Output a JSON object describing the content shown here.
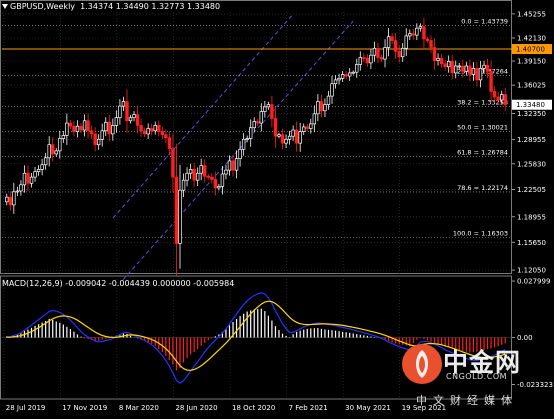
{
  "header": {
    "symbol": "GBPUSD,Weekly",
    "ohlc": "1.34374 1.34490 1.32773 1.33480"
  },
  "macd_header": "MACD(12,26,9) -0.009042 -0.004439 0.000000 -0.005984",
  "watermark": {
    "brand": "中金网",
    "domain": "CNGOLD.COM",
    "subtitle": "中文财经媒体"
  },
  "colors": {
    "background": "#000000",
    "grid": "#3a3a3a",
    "bull_candle": "#ffffff",
    "bear_candle": "#ff2020",
    "fib_line": "#bdbdbd",
    "resistance_line": "#ff9900",
    "price_tag": "#ffffff",
    "channel": "#5a4fd8",
    "macd_signal": "#ffd800",
    "macd_main": "#2233ff",
    "histogram_pos": "#ffffff",
    "histogram_neg": "#ff1f1f",
    "watermark_logo": "#e8502e"
  },
  "chart_data": [
    {
      "type": "candlestick",
      "title": "GBPUSD,Weekly",
      "ylim": [
        1.118,
        1.455
      ],
      "y_ticks": [
        "1.45255",
        "1.42130",
        "1.39150",
        "1.36025",
        "1.32350",
        "1.28955",
        "1.25830",
        "1.22505",
        "1.18955",
        "1.15650",
        "1.12050"
      ],
      "x_ticks": [
        "28 Jul 2019",
        "17 Nov 2019",
        "8 Mar 2020",
        "28 Jun 2020",
        "18 Oct 2020",
        "7 Feb 2021",
        "30 May 2021",
        "19 Sep 2021"
      ],
      "resistance": {
        "value": 1.407,
        "label": "1.40700"
      },
      "current_price": {
        "value": 1.3348,
        "label": "1.33480"
      },
      "fibonacci": [
        {
          "label": "0.0 = 1.43739",
          "value": 1.43739
        },
        {
          "label": "23.6 = 1.37264",
          "value": 1.37264
        },
        {
          "label": "38.2 = 1.33258",
          "value": 1.33258
        },
        {
          "label": "50.0 = 1.30021",
          "value": 1.30021
        },
        {
          "label": "61.8 = 1.26784",
          "value": 1.26784
        },
        {
          "label": "78.6 = 1.22174",
          "value": 1.22174
        },
        {
          "label": "100.0 = 1.16303",
          "value": 1.16303
        }
      ],
      "channel": {
        "upper": [
          {
            "t": 113,
            "price": 1.188
          },
          {
            "t": 293,
            "price": 1.452
          }
        ],
        "lower": [
          {
            "t": 123,
            "price": 1.108
          },
          {
            "t": 353,
            "price": 1.443
          }
        ]
      },
      "close": [
        1.215,
        1.205,
        1.222,
        1.223,
        1.231,
        1.246,
        1.233,
        1.241,
        1.248,
        1.251,
        1.257,
        1.266,
        1.283,
        1.271,
        1.275,
        1.291,
        1.295,
        1.311,
        1.307,
        1.3,
        1.307,
        1.302,
        1.314,
        1.301,
        1.297,
        1.283,
        1.29,
        1.301,
        1.312,
        1.297,
        1.308,
        1.318,
        1.333,
        1.339,
        1.314,
        1.318,
        1.322,
        1.308,
        1.301,
        1.297,
        1.304,
        1.301,
        1.308,
        1.3,
        1.296,
        1.292,
        1.278,
        1.241,
        1.155,
        1.224,
        1.237,
        1.246,
        1.251,
        1.237,
        1.246,
        1.256,
        1.242,
        1.241,
        1.238,
        1.227,
        1.229,
        1.245,
        1.25,
        1.262,
        1.25,
        1.265,
        1.277,
        1.29,
        1.291,
        1.305,
        1.313,
        1.311,
        1.326,
        1.332,
        1.335,
        1.317,
        1.294,
        1.296,
        1.285,
        1.29,
        1.294,
        1.302,
        1.285,
        1.3,
        1.306,
        1.304,
        1.31,
        1.323,
        1.339,
        1.327,
        1.335,
        1.346,
        1.362,
        1.367,
        1.369,
        1.374,
        1.372,
        1.376,
        1.377,
        1.387,
        1.396,
        1.395,
        1.389,
        1.399,
        1.408,
        1.396,
        1.394,
        1.409,
        1.423,
        1.418,
        1.404,
        1.397,
        1.408,
        1.424,
        1.427,
        1.425,
        1.434,
        1.436,
        1.42,
        1.418,
        1.409,
        1.392,
        1.395,
        1.388,
        1.384,
        1.391,
        1.376,
        1.385,
        1.385,
        1.378,
        1.385,
        1.374,
        1.382,
        1.367,
        1.382,
        1.386,
        1.378,
        1.352,
        1.345,
        1.341,
        1.348,
        1.335
      ],
      "histogram": [
        0.0006,
        0.0003,
        0.0011,
        0.0014,
        0.0021,
        0.0032,
        0.0039,
        0.0048,
        0.0058,
        0.0066,
        0.0074,
        0.0082,
        0.0092,
        0.0087,
        0.0079,
        0.0073,
        0.0064,
        0.0053,
        0.0042,
        0.0029,
        0.0015,
        0.0004,
        -0.0004,
        -0.0007,
        -0.0012,
        -0.0019,
        -0.0016,
        -0.0011,
        -0.0006,
        -0.0004,
        0.0002,
        0.0009,
        0.0016,
        0.0021,
        0.0018,
        0.0008,
        -0.0001,
        -0.0006,
        -0.0011,
        -0.0016,
        -0.0023,
        -0.0031,
        -0.0043,
        -0.0057,
        -0.0072,
        -0.0091,
        -0.0112,
        -0.0134,
        -0.0162,
        -0.0151,
        -0.0124,
        -0.0102,
        -0.0085,
        -0.0072,
        -0.0058,
        -0.0041,
        -0.0027,
        -0.0014,
        -0.0005,
        0.0006,
        0.0015,
        0.0028,
        0.0043,
        0.006,
        0.0077,
        0.0092,
        0.0106,
        0.0118,
        0.0129,
        0.0134,
        0.0139,
        0.0141,
        0.0143,
        0.0131,
        0.0108,
        0.0084,
        0.0056,
        0.0037,
        0.0019,
        0.0008,
        0.0002,
        0.0016,
        0.0028,
        0.0034,
        0.0039,
        0.0043,
        0.0045,
        0.0046,
        0.0047,
        0.0043,
        0.004,
        0.0038,
        0.0036,
        0.0034,
        0.0031,
        0.0028,
        0.0026,
        0.0023,
        0.002,
        0.0017,
        0.0014,
        0.0011,
        0.0008,
        0.0005,
        0.0002,
        -0.0003,
        -0.0008,
        -0.0014,
        -0.0021,
        -0.0025,
        -0.003,
        -0.0034,
        -0.0036,
        -0.004,
        -0.0044,
        -0.0028,
        -0.0012,
        -0.0002,
        -0.0009,
        -0.0014,
        -0.0021,
        -0.0027,
        -0.0032,
        -0.0038,
        -0.0046,
        -0.0049,
        -0.0053,
        -0.0058,
        -0.0062,
        -0.0066,
        -0.007,
        -0.0074,
        -0.0073,
        -0.0071,
        -0.0066,
        -0.0062,
        -0.0058,
        -0.0054,
        -0.0049,
        -0.0044,
        -0.0036,
        -0.0029
      ],
      "macd_ylim": [
        -0.03,
        0.03
      ],
      "macd_y_ticks": [
        "0.027999",
        "0.00",
        "-0.023323"
      ]
    }
  ]
}
